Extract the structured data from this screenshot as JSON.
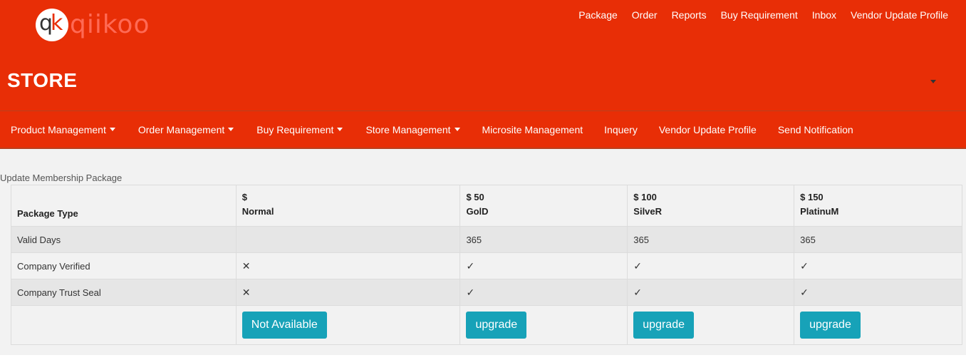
{
  "brand": {
    "logo_text": "qiikoo",
    "monogram_q": "q",
    "monogram_k": "k"
  },
  "topnav": [
    "Package",
    "Order",
    "Reports",
    "Buy Requirement",
    "Inbox",
    "Vendor Update Profile"
  ],
  "store": {
    "title": "STORE"
  },
  "mainnav": [
    {
      "label": "Product Management",
      "dropdown": true
    },
    {
      "label": "Order Management",
      "dropdown": true
    },
    {
      "label": "Buy Requirement",
      "dropdown": true
    },
    {
      "label": "Store Management",
      "dropdown": true
    },
    {
      "label": "Microsite Management",
      "dropdown": false
    },
    {
      "label": "Inquery",
      "dropdown": false
    },
    {
      "label": "Vendor Update Profile",
      "dropdown": false
    },
    {
      "label": "Send Notification",
      "dropdown": false
    }
  ],
  "section": {
    "title": "Update Membership Package"
  },
  "table": {
    "header_label": "Package Type",
    "packages": [
      {
        "price": "$",
        "name": "Normal",
        "button": "Not Available"
      },
      {
        "price": "$ 50",
        "name": "GolD",
        "button": "upgrade"
      },
      {
        "price": "$ 100",
        "name": "SilveR",
        "button": "upgrade"
      },
      {
        "price": "$ 150",
        "name": "PlatinuM",
        "button": "upgrade"
      }
    ],
    "rows": [
      {
        "label": "Valid Days",
        "values": [
          "",
          "365",
          "365",
          "365"
        ]
      },
      {
        "label": "Company Verified",
        "values": [
          "✕",
          "✓",
          "✓",
          "✓"
        ]
      },
      {
        "label": "Company Trust Seal",
        "values": [
          "✕",
          "✓",
          "✓",
          "✓"
        ]
      }
    ]
  },
  "colors": {
    "header_bg": "#e82e06",
    "button_bg": "#17a2b8",
    "content_bg": "#f2f2f2"
  }
}
